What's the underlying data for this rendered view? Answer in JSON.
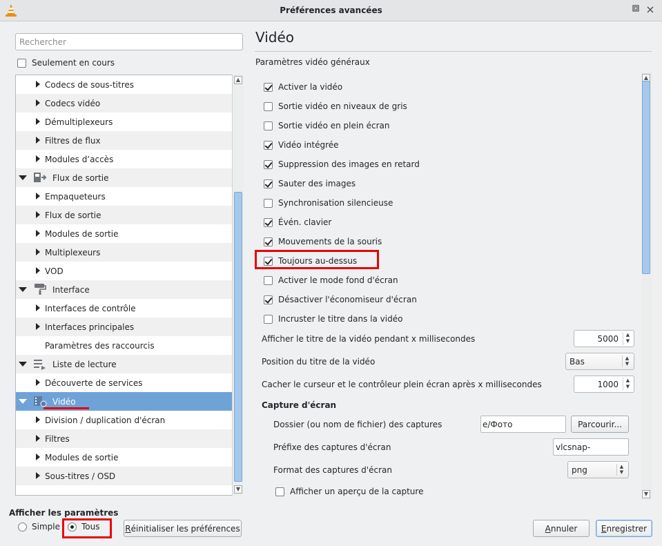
{
  "window": {
    "title": "Préférences avancées"
  },
  "search": {
    "placeholder": "Rechercher"
  },
  "only_current": {
    "label": "Seulement en cours",
    "checked": false
  },
  "tree": {
    "items": [
      {
        "label": "Codecs de sous-titres",
        "level": 1,
        "arrow": "right"
      },
      {
        "label": "Codecs vidéo",
        "level": 1,
        "arrow": "right"
      },
      {
        "label": "Démultiplexeurs",
        "level": 1,
        "arrow": "right"
      },
      {
        "label": "Filtres de flux",
        "level": 1,
        "arrow": "right"
      },
      {
        "label": "Modules d’accès",
        "level": 1,
        "arrow": "right"
      },
      {
        "label": "Flux de sortie",
        "level": 0,
        "arrow": "down",
        "icon": "stream-output-icon"
      },
      {
        "label": "Empaqueteurs",
        "level": 1,
        "arrow": "right"
      },
      {
        "label": "Flux de sortie",
        "level": 1,
        "arrow": "right"
      },
      {
        "label": "Modules de sortie",
        "level": 1,
        "arrow": "right"
      },
      {
        "label": "Multiplexeurs",
        "level": 1,
        "arrow": "right"
      },
      {
        "label": "VOD",
        "level": 1,
        "arrow": "right"
      },
      {
        "label": "Interface",
        "level": 0,
        "arrow": "down",
        "icon": "paint-roller-icon"
      },
      {
        "label": "Interfaces de contrôle",
        "level": 1,
        "arrow": "right"
      },
      {
        "label": "Interfaces principales",
        "level": 1,
        "arrow": "right"
      },
      {
        "label": "Paramètres des raccourcis",
        "level": 1,
        "arrow": "none"
      },
      {
        "label": "Liste de lecture",
        "level": 0,
        "arrow": "down",
        "icon": "playlist-icon"
      },
      {
        "label": "Découverte de services",
        "level": 1,
        "arrow": "right"
      },
      {
        "label": "Vidéo",
        "level": 0,
        "arrow": "down",
        "icon": "video-icon",
        "selected": true
      },
      {
        "label": "Division / duplication d'écran",
        "level": 1,
        "arrow": "right"
      },
      {
        "label": "Filtres",
        "level": 1,
        "arrow": "right"
      },
      {
        "label": "Modules de sortie",
        "level": 1,
        "arrow": "right"
      },
      {
        "label": "Sous-titres / OSD",
        "level": 1,
        "arrow": "right"
      }
    ]
  },
  "section": {
    "title": "Vidéo",
    "general_label": "Paramètres vidéo généraux"
  },
  "options": [
    {
      "label": "Activer la vidéo",
      "checked": true
    },
    {
      "label": "Sortie vidéo en niveaux de gris",
      "checked": false
    },
    {
      "label": "Sortie vidéo en plein écran",
      "checked": false
    },
    {
      "label": "Vidéo intégrée",
      "checked": true
    },
    {
      "label": "Suppression des images en retard",
      "checked": true
    },
    {
      "label": "Sauter des images",
      "checked": true
    },
    {
      "label": "Synchronisation silencieuse",
      "checked": false
    },
    {
      "label": "Évén. clavier",
      "checked": true
    },
    {
      "label": "Mouvements de la souris",
      "checked": true
    },
    {
      "label": "Toujours au-dessus",
      "checked": true
    },
    {
      "label": "Activer le mode fond d'écran",
      "checked": false
    },
    {
      "label": "Désactiver l'économiseur d'écran",
      "checked": true
    },
    {
      "label": "Incruster le titre dans la vidéo",
      "checked": false
    }
  ],
  "fields": {
    "title_duration": {
      "label": "Afficher le titre de la vidéo pendant x millisecondes",
      "value": "5000"
    },
    "title_position": {
      "label": "Position du titre de la vidéo",
      "value": "Bas"
    },
    "hide_cursor": {
      "label": "Cacher le curseur et le contrôleur plein écran après x millisecondes",
      "value": "1000"
    }
  },
  "snapshot": {
    "heading": "Capture d'écran",
    "folder_label": "Dossier (ou nom de fichier) des captures",
    "folder_value": "e/Фото",
    "browse_label": "Parcourir...",
    "prefix_label": "Préfixe des captures d'écran",
    "prefix_value": "vlcsnap-",
    "format_label": "Format des captures d'écran",
    "format_value": "png",
    "preview_label": "Afficher un aperçu de la capture",
    "preview_checked": false
  },
  "footer": {
    "display_label": "Afficher les paramètres",
    "simple_label": "Simple",
    "all_label": "Tous",
    "selected": "all",
    "reset_label": "Réinitialiser les préférences",
    "reset_mnemonic": "R",
    "reset_rest": "éinitialiser les préférences",
    "cancel_mnemonic": "A",
    "cancel_rest": "nnuler",
    "save_mnemonic": "E",
    "save_rest": "nregistrer"
  },
  "colors": {
    "highlight": "#e8000b",
    "selection": "#6fa3d8"
  }
}
